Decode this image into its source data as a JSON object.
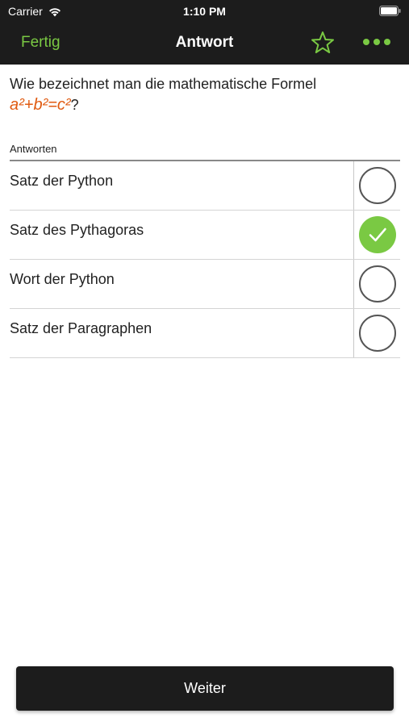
{
  "status_bar": {
    "carrier": "Carrier",
    "time": "1:10 PM"
  },
  "nav": {
    "done_label": "Fertig",
    "title": "Antwort",
    "accent_color": "#7ac943"
  },
  "question": {
    "text": "Wie bezeichnet man die mathematische Formel",
    "formula": "a²+b²=c²",
    "suffix": "?",
    "formula_color": "#e05a10"
  },
  "answers_label": "Antworten",
  "answers": [
    {
      "label": "Satz der Python",
      "checked": false
    },
    {
      "label": "Satz des Pythagoras",
      "checked": true
    },
    {
      "label": "Wort der Python",
      "checked": false
    },
    {
      "label": "Satz der Paragraphen",
      "checked": false
    }
  ],
  "next_button": "Weiter"
}
